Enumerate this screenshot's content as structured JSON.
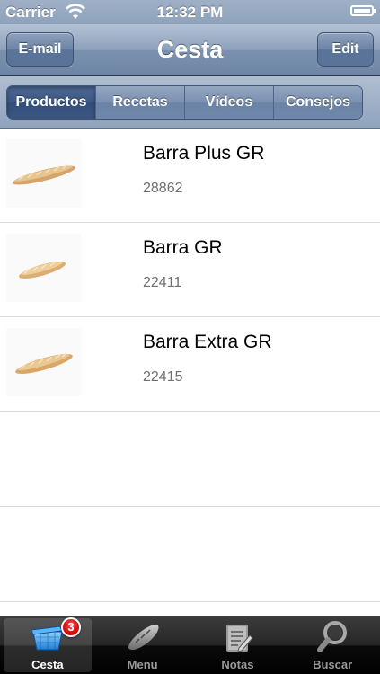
{
  "status_bar": {
    "carrier": "Carrier",
    "time": "12:32 PM"
  },
  "nav": {
    "title": "Cesta",
    "left_button": "E-mail",
    "right_button": "Edit"
  },
  "segments": [
    "Productos",
    "Recetas",
    "Vídeos",
    "Consejos"
  ],
  "selected_segment": "Productos",
  "products": [
    {
      "name": "Barra Plus GR",
      "code": "28862",
      "icon": "baguette-image"
    },
    {
      "name": "Barra GR",
      "code": "22411",
      "icon": "baguette-image"
    },
    {
      "name": "Barra Extra GR",
      "code": "22415",
      "icon": "baguette-image"
    }
  ],
  "tabs": [
    {
      "label": "Cesta",
      "icon": "basket-icon",
      "badge": "3",
      "active": true
    },
    {
      "label": "Menu",
      "icon": "bread-icon",
      "active": false
    },
    {
      "label": "Notas",
      "icon": "notes-icon",
      "active": false
    },
    {
      "label": "Buscar",
      "icon": "search-icon",
      "active": false
    }
  ],
  "colors": {
    "nav_blue": "#7b91ae",
    "segment_active": "#3b5683",
    "badge_red": "#d30b0b"
  }
}
